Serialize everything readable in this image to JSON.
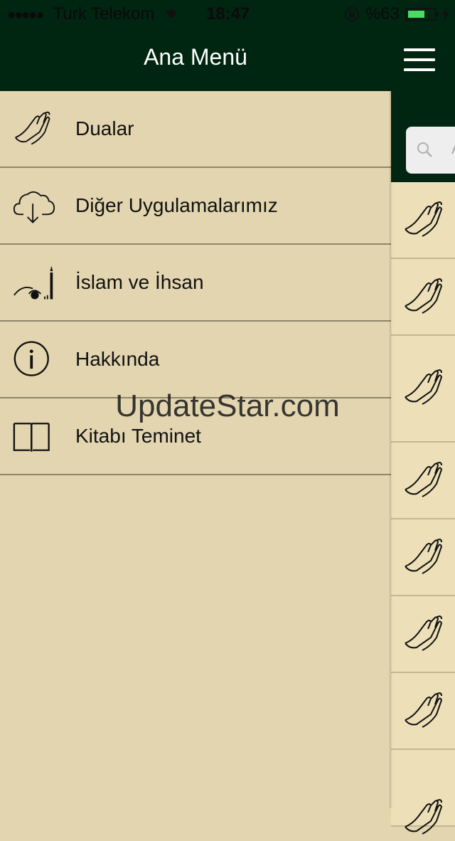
{
  "status_bar": {
    "signal": "●●●●●",
    "carrier": "Turk Telekom",
    "wifi": "wifi-icon",
    "time": "18:47",
    "lock": "orientation-lock-icon",
    "battery_text": "%63",
    "battery_level": 0.63,
    "charging": "bolt-icon"
  },
  "header": {
    "title": "Ana Menü",
    "menu_icon": "hamburger-icon"
  },
  "menu": {
    "items": [
      {
        "label": "Dualar",
        "icon": "praying-hands-icon"
      },
      {
        "label": "Diğer Uygulamalarımız",
        "icon": "cloud-download-icon"
      },
      {
        "label": "İslam ve İhsan",
        "icon": "mosque-icon"
      },
      {
        "label": "Hakkında",
        "icon": "info-icon"
      },
      {
        "label": "Kitabı Teminet",
        "icon": "book-icon"
      }
    ]
  },
  "side_content": {
    "search_icon": "search-icon",
    "search_placeholder_fragment": "A",
    "rows_icon": "praying-hands-icon"
  },
  "watermark": "UpdateStar.com",
  "colors": {
    "header_bg": "#002510",
    "menu_bg": "#e2d5b0",
    "divider": "#8f8568",
    "battery": "#4cd964"
  }
}
